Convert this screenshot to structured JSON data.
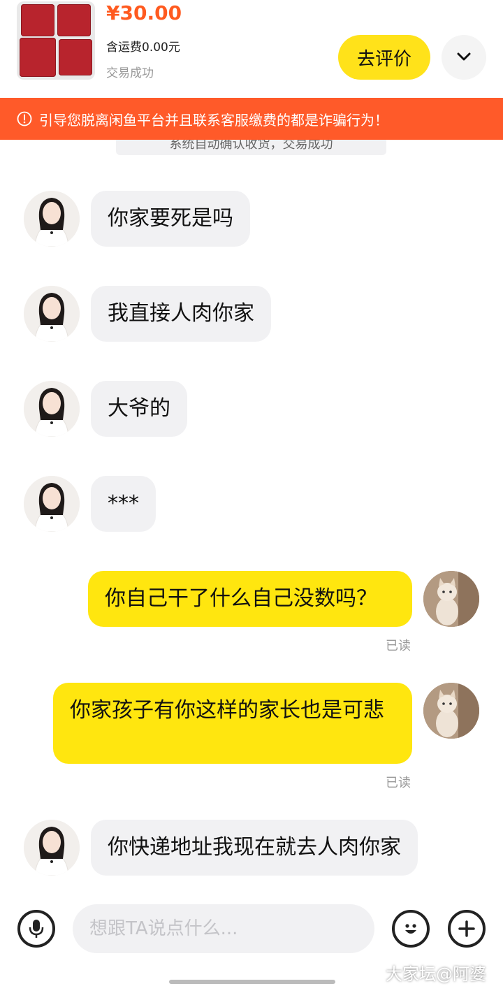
{
  "order": {
    "price": "¥30.00",
    "shipping": "含运费0.00元",
    "status": "交易成功",
    "review_button": "去评价",
    "expand_icon": "chevron-down-icon"
  },
  "warning": {
    "icon": "alert-circle-icon",
    "text": "引导您脱离闲鱼平台并且联系客服缴费的都是诈骗行为！"
  },
  "system_message": "系统自动确认收货，交易成功",
  "messages": [
    {
      "side": "in",
      "text": "你家要死是吗"
    },
    {
      "side": "in",
      "text": "我直接人肉你家"
    },
    {
      "side": "in",
      "text": "大爷的"
    },
    {
      "side": "in",
      "text": "***"
    },
    {
      "side": "out",
      "text": "你自己干了什么自己没数吗？",
      "status": "已读"
    },
    {
      "side": "out",
      "text": "你家孩子有你这样的家长也是可悲",
      "status": "已读"
    },
    {
      "side": "in",
      "text": "你快递地址我现在就去人肉你家"
    }
  ],
  "input_bar": {
    "voice_icon": "microphone-icon",
    "placeholder": "想跟TA说点什么...",
    "emoji_icon": "emoji-icon",
    "plus_icon": "plus-icon"
  },
  "watermark": "大家坛@阿婆",
  "colors": {
    "price": "#ff5a1f",
    "warning_bg": "#ff5a29",
    "accent_yellow": "#ffe60f",
    "incoming_bubble": "#f1f1f3"
  }
}
